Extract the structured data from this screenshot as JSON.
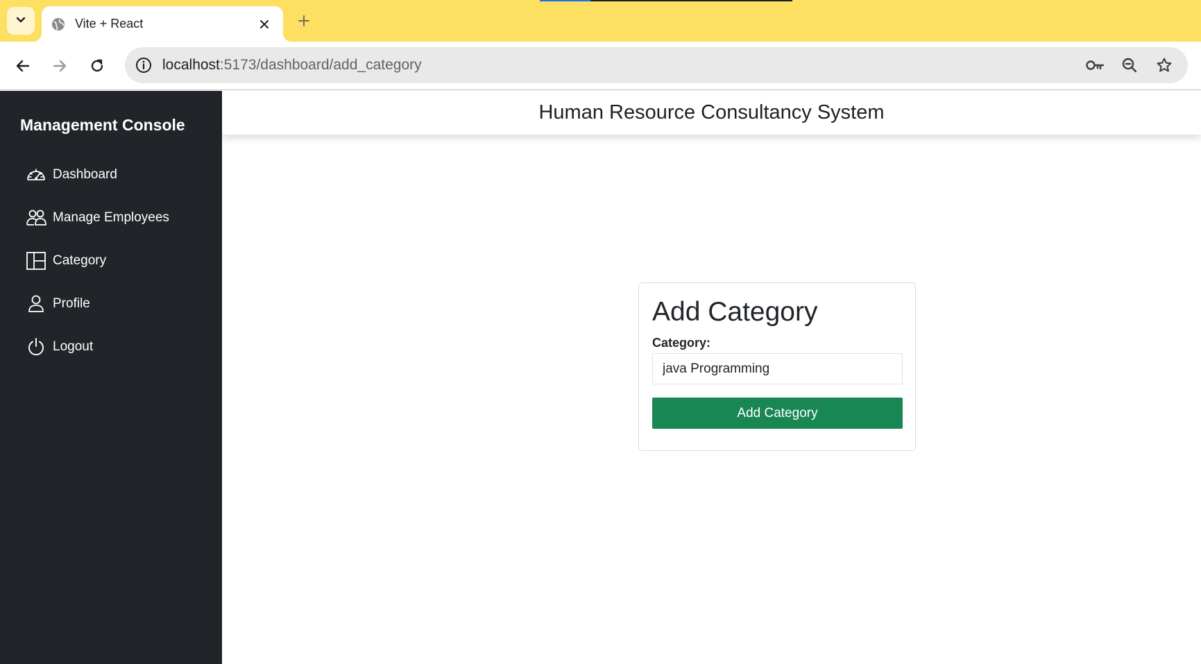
{
  "browser": {
    "load_progress": 0.2,
    "tab": {
      "title": "Vite + React",
      "favicon": "globe-icon"
    },
    "url": {
      "host": "localhost",
      "path": ":5173/dashboard/add_category"
    },
    "icons": [
      "tab-list-icon",
      "close-icon",
      "plus-icon",
      "back-arrow-icon",
      "forward-arrow-icon",
      "reload-icon",
      "info-icon",
      "key-icon",
      "zoom-icon",
      "star-icon"
    ]
  },
  "sidebar": {
    "brand": "Management Console",
    "items": [
      {
        "label": "Dashboard",
        "icon": "speedometer-icon"
      },
      {
        "label": "Manage Employees",
        "icon": "people-icon"
      },
      {
        "label": "Category",
        "icon": "columns-icon"
      },
      {
        "label": "Profile",
        "icon": "person-icon"
      },
      {
        "label": "Logout",
        "icon": "power-icon"
      }
    ]
  },
  "header": {
    "title": "Human Resource Consultancy System"
  },
  "form": {
    "title": "Add Category",
    "label": "Category:",
    "value": "java Programming",
    "submit_label": "Add Category"
  },
  "colors": {
    "tabstrip": "#fddf62",
    "sidebar": "#212529",
    "primary_button": "#198754"
  }
}
